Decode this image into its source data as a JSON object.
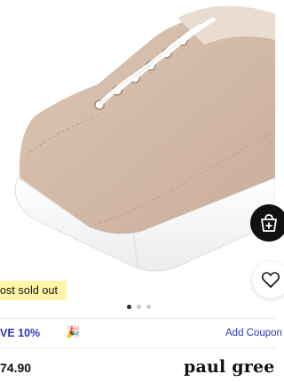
{
  "product": {
    "image_alt": "Beige suede platform sneaker with white laces",
    "badge": "ost sold out",
    "price": "74.90",
    "brand": "paul gree"
  },
  "icons": {
    "bag": "shopping-bag-plus-icon",
    "wishlist": "heart-outline-icon",
    "promo": "party-popper-icon"
  },
  "gallery": {
    "total": 3,
    "active": 1
  },
  "promo": {
    "text": "VE 10%",
    "emoji": "🎉",
    "coupon_label": "Add Coupon"
  },
  "colors": {
    "promo_blue": "#2f38c7",
    "badge_yellow": "#fff5a8",
    "shoe_beige": "#d7beab"
  }
}
